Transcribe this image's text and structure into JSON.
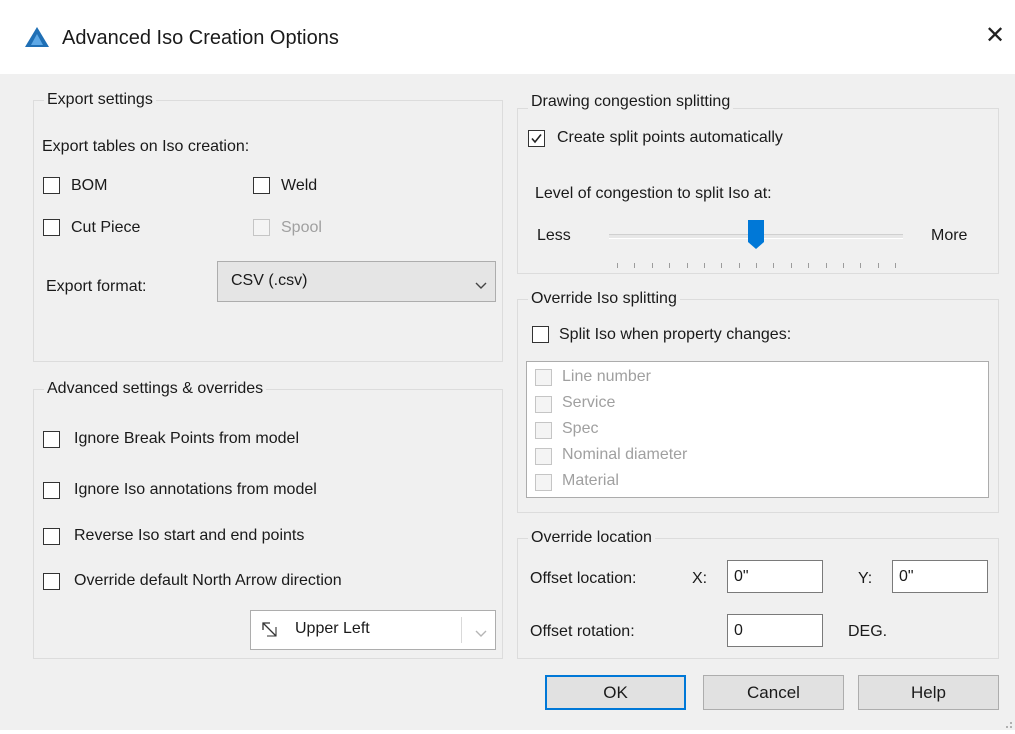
{
  "window": {
    "title": "Advanced Iso Creation Options",
    "icon": "autocad-plant-triangle-icon",
    "close_glyph": "✕"
  },
  "export_settings": {
    "legend": "Export settings",
    "tables_label": "Export tables on Iso creation:",
    "checkboxes": {
      "bom": {
        "label": "BOM",
        "checked": false,
        "enabled": true
      },
      "weld": {
        "label": "Weld",
        "checked": false,
        "enabled": true
      },
      "cut_piece": {
        "label": "Cut Piece",
        "checked": false,
        "enabled": true
      },
      "spool": {
        "label": "Spool",
        "checked": false,
        "enabled": false
      }
    },
    "format_label": "Export format:",
    "format_value": "CSV (.csv)"
  },
  "advanced": {
    "legend": "Advanced settings & overrides",
    "options": [
      {
        "label": "Ignore Break Points from model",
        "checked": false
      },
      {
        "label": "Ignore Iso annotations from model",
        "checked": false
      },
      {
        "label": "Reverse Iso start and end points",
        "checked": false
      },
      {
        "label": "Override default North Arrow direction",
        "checked": false
      }
    ],
    "north_arrow_value": "Upper Left",
    "north_arrow_icon": "north-arrow-upper-left-icon"
  },
  "congestion": {
    "legend": "Drawing congestion splitting",
    "auto_label": "Create split points automatically",
    "auto_checked": true,
    "level_label": "Level of congestion to split Iso at:",
    "less_label": "Less",
    "more_label": "More",
    "slider_level": 0.5,
    "tick_count": 17
  },
  "override_split": {
    "legend": "Override Iso splitting",
    "split_label": "Split Iso when property changes:",
    "split_checked": false,
    "properties": [
      {
        "label": "Line number",
        "checked": false
      },
      {
        "label": "Service",
        "checked": false
      },
      {
        "label": "Spec",
        "checked": false
      },
      {
        "label": "Nominal diameter",
        "checked": false
      },
      {
        "label": "Material",
        "checked": false
      }
    ]
  },
  "override_location": {
    "legend": "Override location",
    "offset_label": "Offset location:",
    "x_label": "X:",
    "x_value": "0\"",
    "y_label": "Y:",
    "y_value": "0\"",
    "rotation_label": "Offset rotation:",
    "rotation_value": "0",
    "rotation_unit": "DEG."
  },
  "buttons": {
    "ok": "OK",
    "cancel": "Cancel",
    "help": "Help"
  },
  "colors": {
    "accent": "#0078d7",
    "app_icon": "#1f6fb5",
    "dialog_bg": "#f0f0f0"
  }
}
